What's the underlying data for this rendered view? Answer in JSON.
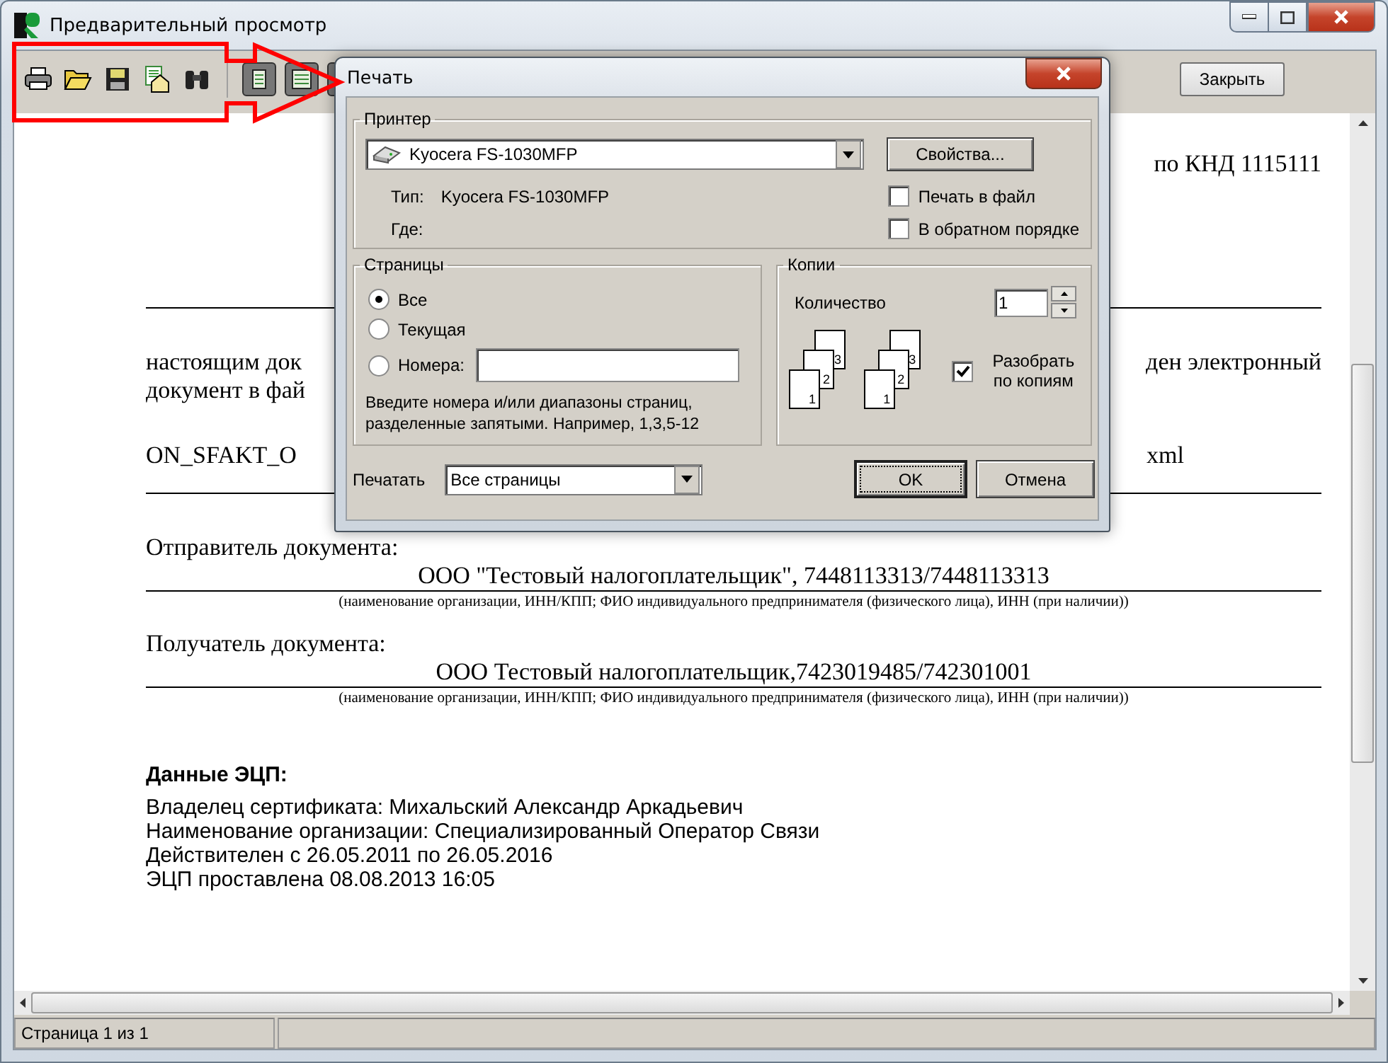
{
  "window": {
    "title": "Предварительный просмотр"
  },
  "toolbar": {
    "close_button": "Закрыть"
  },
  "document": {
    "header_right": "по КНД 1115111",
    "paragraph_lines": [
      {
        "left": "настоящим док",
        "right": "ден электронный"
      },
      {
        "left": "документ в фай"
      }
    ],
    "file_line": {
      "left": "ON_SFAKT_O",
      "right": "xml"
    },
    "parties": [
      {
        "label": "Отправитель документа:",
        "value": "ООО \"Тестовый налогоплательщик\", 7448113313/7448113313",
        "caption": "(наименование организации, ИНН/КПП;  ФИО индивидуального предпринимателя (физического лица), ИНН (при наличии))"
      },
      {
        "label": "Получатель документа:",
        "value": "ООО Тестовый налогоплательщик,7423019485/742301001",
        "caption": "(наименование организации, ИНН/КПП;  ФИО индивидуального предпринимателя (физического лица), ИНН (при наличии))"
      }
    ],
    "signature": {
      "title": "Данные ЭЦП:",
      "lines": [
        "Владелец сертификата: Михальский Александр Аркадьевич",
        "Наименование организации: Специализированный Оператор Связи",
        "Действителен с 26.05.2011 по 26.05.2016",
        "ЭЦП проставлена 08.08.2013 16:05"
      ]
    }
  },
  "status_bar": {
    "page": "Страница 1 из 1"
  },
  "print_dialog": {
    "title": "Печать",
    "printer": {
      "legend": "Принтер",
      "name": "Kyocera FS-1030MFP",
      "properties_button": "Свойства...",
      "type_label": "Тип:",
      "type_value": "Kyocera FS-1030MFP",
      "where_label": "Где:",
      "options": [
        {
          "label": "Печать в файл",
          "checked": false
        },
        {
          "label": "В обратном порядке",
          "checked": false
        }
      ]
    },
    "pages": {
      "legend": "Страницы",
      "ranges": [
        {
          "label": "Все",
          "selected": true,
          "kind": "plain"
        },
        {
          "label": "Текущая",
          "selected": false,
          "kind": "plain"
        },
        {
          "label": "Номера:",
          "selected": false,
          "kind": "field"
        }
      ],
      "hint_lines": [
        "Введите номера и/или диапазоны страниц,",
        "разделенные запятыми. Например, 1,3,5-12"
      ]
    },
    "copies": {
      "legend": "Копии",
      "count_label": "Количество",
      "count": "1",
      "stacks": [
        [
          "3",
          "2",
          "1"
        ],
        [
          "3",
          "2",
          "1"
        ]
      ],
      "collate": {
        "label": "Разобрать по копиям",
        "checked": true
      }
    },
    "print_range": {
      "label": "Печатать",
      "value": "Все страницы"
    },
    "buttons": [
      {
        "label": "OK",
        "default": true
      },
      {
        "label": "Отмена",
        "default": false
      }
    ]
  }
}
